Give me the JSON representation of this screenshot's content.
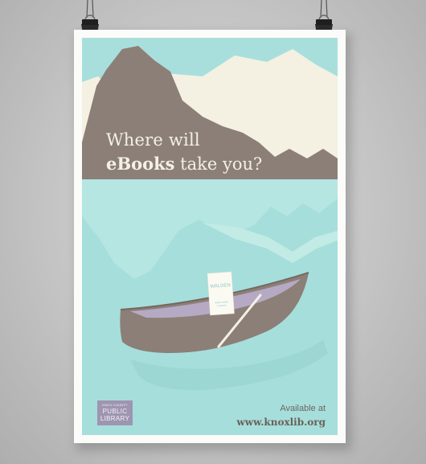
{
  "poster": {
    "headline_line1": "Where will",
    "headline_bold": "eBooks",
    "headline_rest": " take you?",
    "book_title": "WALDEN",
    "book_author": "HENRY DAVID THOREAU",
    "logo_line1": "KNOX COUNTY",
    "logo_line2": "PUBLIC",
    "logo_line3": "LIBRARY",
    "available_label": "Available at",
    "website": "www.knoxlib.org"
  },
  "colors": {
    "sky": "#a6dedc",
    "mountain": "#8c7f77",
    "snow_peaks": "#f4f1e2",
    "water_light": "#b2e5e1",
    "canoe": "#8c7f77",
    "logo": "#9e95b2"
  }
}
